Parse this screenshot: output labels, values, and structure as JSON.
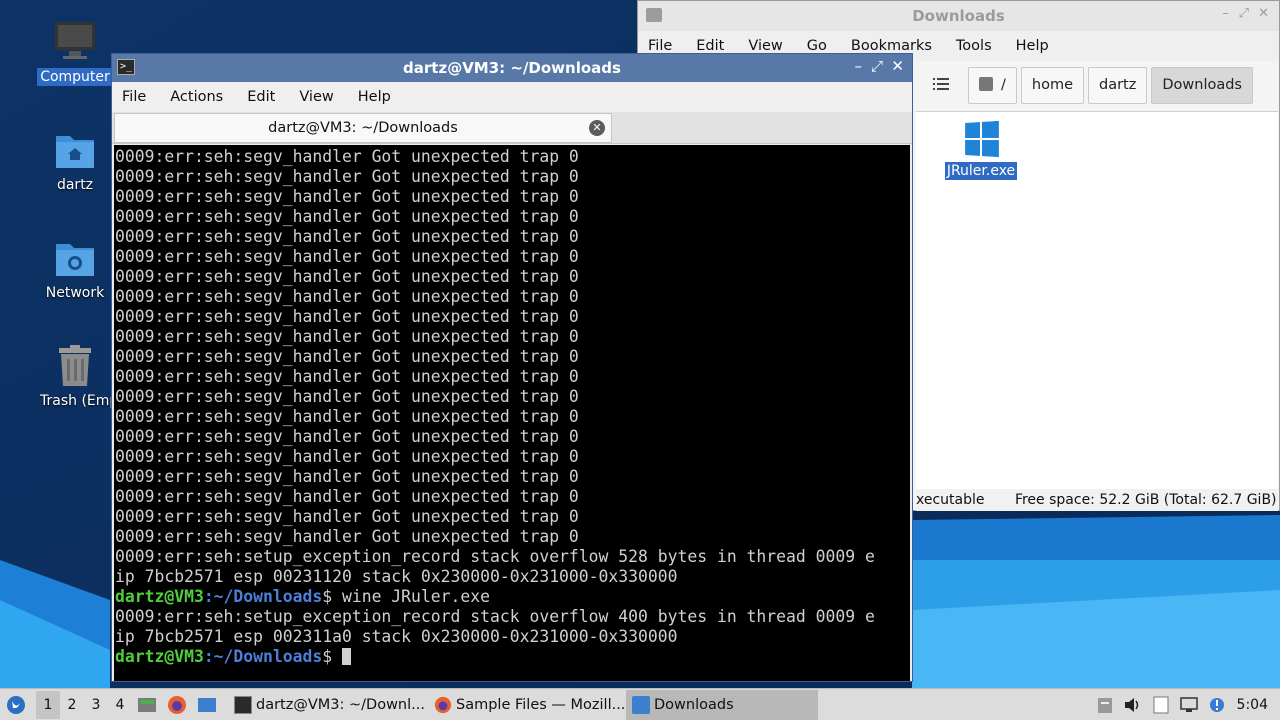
{
  "desktop": {
    "icons": [
      {
        "label": "Computer",
        "icon": "computer-icon",
        "selected": true
      },
      {
        "label": "dartz",
        "icon": "home-folder-icon"
      },
      {
        "label": "Network",
        "icon": "network-folder-icon"
      },
      {
        "label": "Trash (Empty)",
        "icon": "trash-icon"
      }
    ]
  },
  "file_manager": {
    "title": "Downloads",
    "menu": [
      "File",
      "Edit",
      "View",
      "Go",
      "Bookmarks",
      "Tools",
      "Help"
    ],
    "path": [
      "/",
      "home",
      "dartz",
      "Downloads"
    ],
    "files": [
      {
        "name": "JRuler.exe",
        "icon": "windows-exe-icon",
        "selected": true
      }
    ],
    "status": {
      "left": "xecutable",
      "right": "Free space: 52.2 GiB (Total: 62.7 GiB)"
    }
  },
  "terminal": {
    "title": "dartz@VM3: ~/Downloads",
    "menu": [
      "File",
      "Actions",
      "Edit",
      "View",
      "Help"
    ],
    "tab_label": "dartz@VM3: ~/Downloads",
    "lines": [
      {
        "text": "0009:err:seh:segv_handler Got unexpected trap 0"
      },
      {
        "text": "0009:err:seh:segv_handler Got unexpected trap 0"
      },
      {
        "text": "0009:err:seh:segv_handler Got unexpected trap 0"
      },
      {
        "text": "0009:err:seh:segv_handler Got unexpected trap 0"
      },
      {
        "text": "0009:err:seh:segv_handler Got unexpected trap 0"
      },
      {
        "text": "0009:err:seh:segv_handler Got unexpected trap 0"
      },
      {
        "text": "0009:err:seh:segv_handler Got unexpected trap 0"
      },
      {
        "text": "0009:err:seh:segv_handler Got unexpected trap 0"
      },
      {
        "text": "0009:err:seh:segv_handler Got unexpected trap 0"
      },
      {
        "text": "0009:err:seh:segv_handler Got unexpected trap 0"
      },
      {
        "text": "0009:err:seh:segv_handler Got unexpected trap 0"
      },
      {
        "text": "0009:err:seh:segv_handler Got unexpected trap 0"
      },
      {
        "text": "0009:err:seh:segv_handler Got unexpected trap 0"
      },
      {
        "text": "0009:err:seh:segv_handler Got unexpected trap 0"
      },
      {
        "text": "0009:err:seh:segv_handler Got unexpected trap 0"
      },
      {
        "text": "0009:err:seh:segv_handler Got unexpected trap 0"
      },
      {
        "text": "0009:err:seh:segv_handler Got unexpected trap 0"
      },
      {
        "text": "0009:err:seh:segv_handler Got unexpected trap 0"
      },
      {
        "text": "0009:err:seh:segv_handler Got unexpected trap 0"
      },
      {
        "text": "0009:err:seh:segv_handler Got unexpected trap 0"
      },
      {
        "text": "0009:err:seh:setup_exception_record stack overflow 528 bytes in thread 0009 e"
      },
      {
        "text": "ip 7bcb2571 esp 00231120 stack 0x230000-0x231000-0x330000"
      },
      {
        "prompt_user": "dartz@VM3",
        "prompt_path": ":~/Downloads",
        "text": "$ wine JRuler.exe"
      },
      {
        "text": "0009:err:seh:setup_exception_record stack overflow 400 bytes in thread 0009 e"
      },
      {
        "text": "ip 7bcb2571 esp 002311a0 stack 0x230000-0x231000-0x330000"
      },
      {
        "prompt_user": "dartz@VM3",
        "prompt_path": ":~/Downloads",
        "text": "$ ",
        "cursor": true
      }
    ]
  },
  "taskbar": {
    "workspaces": [
      "1",
      "2",
      "3",
      "4"
    ],
    "current_workspace": "1",
    "tasks": [
      {
        "label": "dartz@VM3: ~/Downl...",
        "icon": "terminal-icon"
      },
      {
        "label": "Sample Files — Mozill...",
        "icon": "firefox-icon"
      },
      {
        "label": "Downloads",
        "icon": "folder-icon",
        "active": true
      }
    ],
    "clock": "5:04"
  },
  "colors": {
    "terminal_title": "#5878a8",
    "prompt_user": "#4fcf3a",
    "prompt_path": "#4c7fd8",
    "selection": "#2f6bc4"
  }
}
